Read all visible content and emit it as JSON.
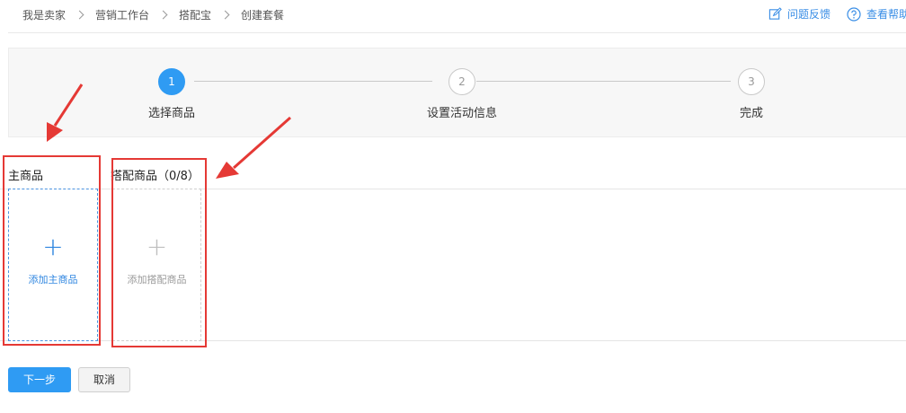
{
  "breadcrumb": {
    "items": [
      "我是卖家",
      "营销工作台",
      "搭配宝",
      "创建套餐"
    ]
  },
  "header": {
    "feedback_label": "问题反馈",
    "help_label": "查看帮助"
  },
  "steps": {
    "current": 1,
    "items": [
      {
        "number": "1",
        "label": "选择商品"
      },
      {
        "number": "2",
        "label": "设置活动信息"
      },
      {
        "number": "3",
        "label": "完成"
      }
    ]
  },
  "main_product": {
    "title": "主商品",
    "add_label": "添加主商品",
    "add_symbol": "+"
  },
  "combo_products": {
    "title": "搭配商品（0/8）",
    "add_label": "添加搭配商品",
    "add_symbol": "+"
  },
  "actions": {
    "next_label": "下一步",
    "cancel_label": "取消"
  },
  "colors": {
    "primary": "#2f9bf3",
    "link": "#3a8ee6",
    "annotation_red": "#e53935"
  }
}
